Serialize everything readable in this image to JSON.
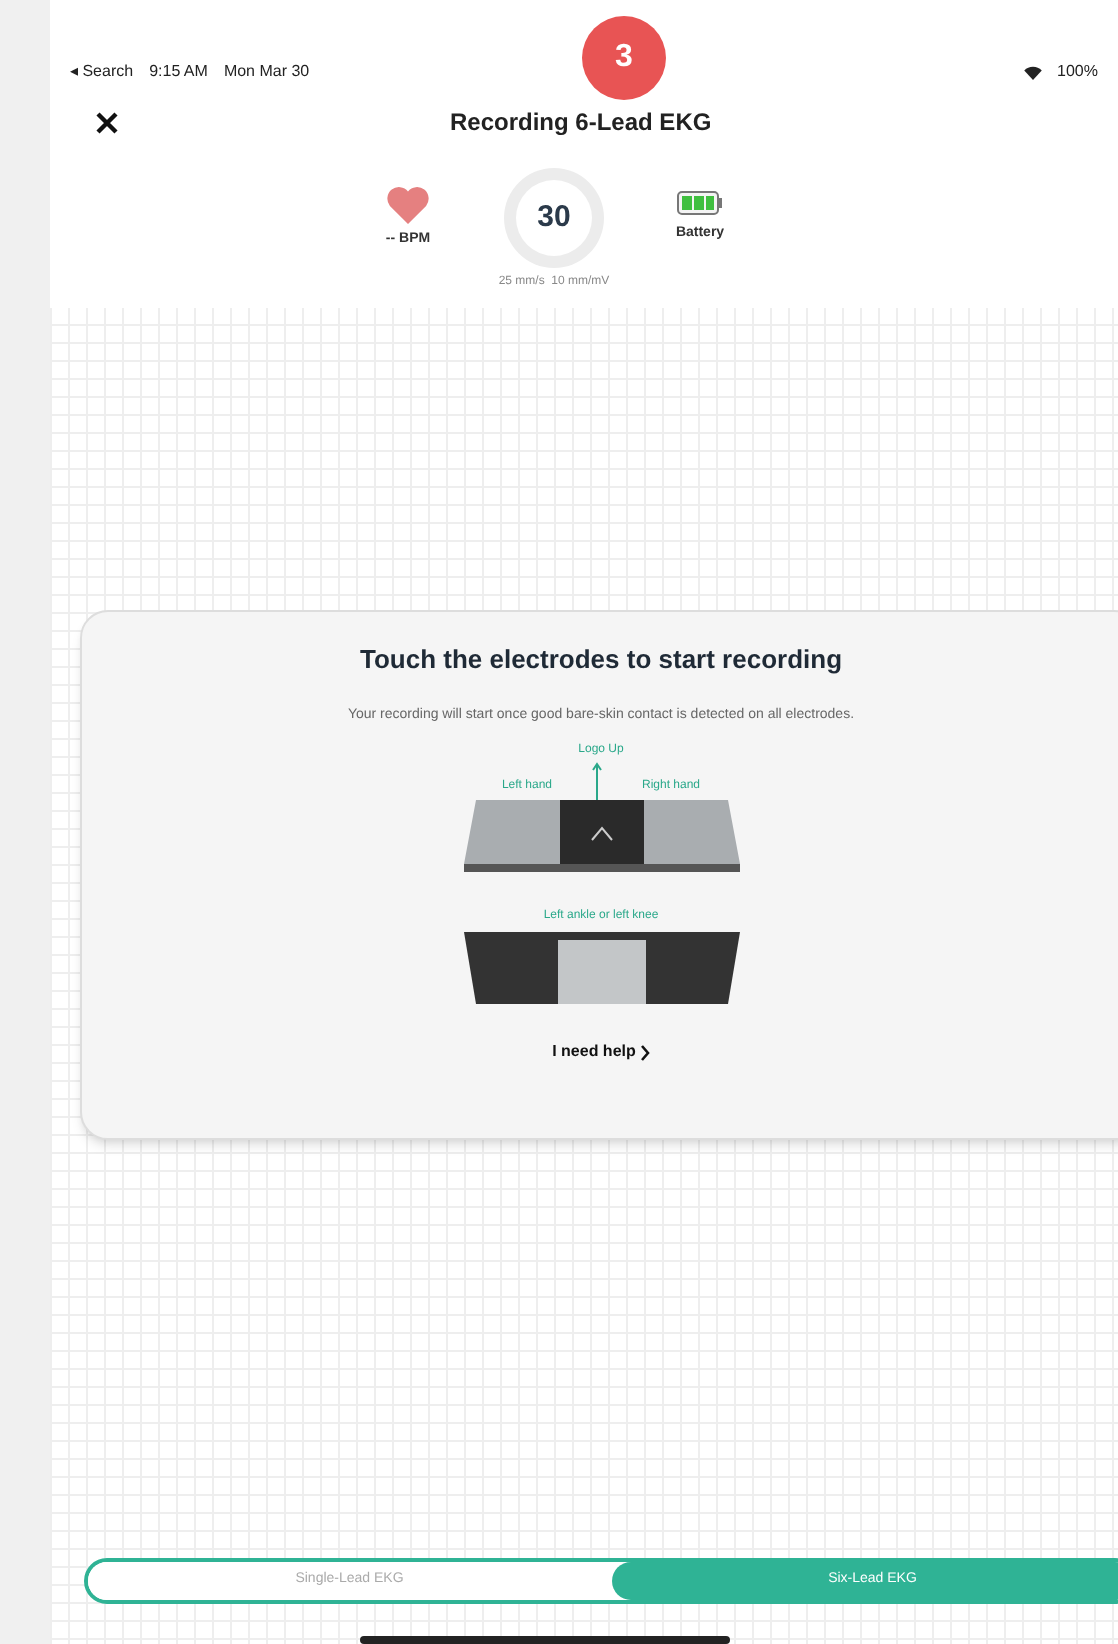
{
  "step_badge": "3",
  "status_bar": {
    "back": "◂ Search",
    "time": "9:15 AM",
    "date": "Mon Mar 30",
    "battery": "100%"
  },
  "nav": {
    "title": "Recording 6-Lead EKG"
  },
  "vitals": {
    "bpm": "-- BPM",
    "counter": "30",
    "battery_label": "Battery",
    "scale": "25 mm/s  10 mm/mV"
  },
  "card": {
    "title": "Touch the electrodes to start recording",
    "subtitle": "Your recording will start once good bare-skin contact is detected on all electrodes.",
    "logo_label": "Logo Up",
    "left_label": "Left hand",
    "right_label": "Right hand",
    "bottom_label": "Left ankle or left knee",
    "help_link": "I need help"
  },
  "segments": [
    {
      "label": "Single-Lead EKG",
      "selected": false
    },
    {
      "label": "Six-Lead EKG",
      "selected": true
    }
  ]
}
